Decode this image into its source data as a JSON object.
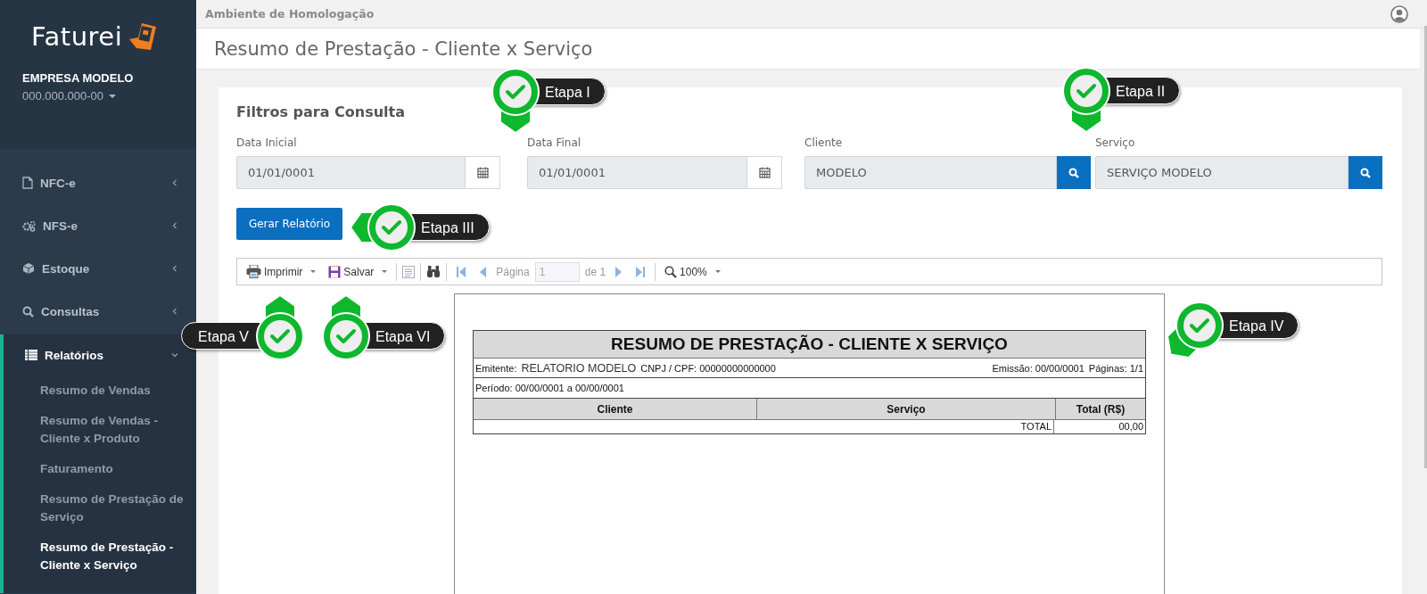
{
  "environment": "Ambiente de Homologação",
  "page_title": "Resumo de Prestação - Cliente x Serviço",
  "sidebar": {
    "logo": "Faturei",
    "company": "EMPRESA MODELO",
    "company_id": "000.000.000-00",
    "items": [
      {
        "label": "NFC-e",
        "kind": "file",
        "expanded": false
      },
      {
        "label": "NFS-e",
        "kind": "gears",
        "expanded": false
      },
      {
        "label": "Estoque",
        "kind": "cube",
        "expanded": false
      },
      {
        "label": "Consultas",
        "kind": "search",
        "expanded": false
      },
      {
        "label": "Relatórios",
        "kind": "list",
        "expanded": true,
        "children": [
          {
            "label": "Resumo de Vendas",
            "selected": false
          },
          {
            "label": "Resumo de Vendas - Cliente x Produto",
            "selected": false
          },
          {
            "label": "Faturamento",
            "selected": false
          },
          {
            "label": "Resumo de Prestação de Serviço",
            "selected": false
          },
          {
            "label": "Resumo de Prestação - Cliente x Serviço",
            "selected": true
          }
        ]
      }
    ]
  },
  "filters": {
    "title": "Filtros para Consulta",
    "fields": [
      {
        "label": "Data Inicial",
        "value": "01/01/0001",
        "kind": "date"
      },
      {
        "label": "Data Final",
        "value": "01/01/0001",
        "kind": "date"
      },
      {
        "label": "Cliente",
        "value": "MODELO",
        "kind": "lookup"
      },
      {
        "label": "Serviço",
        "value": "SERVIÇO MODELO",
        "kind": "lookup"
      }
    ],
    "submit": "Gerar Relatório"
  },
  "viewer": {
    "toolbar": {
      "print": "Imprimir",
      "save": "Salvar",
      "page_label": "Página",
      "page": "1",
      "page_of": "de 1",
      "zoom": "100%"
    },
    "report": {
      "title": "RESUMO DE PRESTAÇÃO - CLIENTE X SERVIÇO",
      "issuer_label": "Emitente:",
      "issuer": "RELATORIO MODELO",
      "tax_id": "CNPJ / CPF: 00000000000000",
      "issued": "Emissão: 00/00/0001",
      "pages": "Páginas: 1/1",
      "period": "Período: 00/00/0001 a 00/00/0001",
      "columns": [
        "Cliente",
        "Serviço",
        "Total (R$)"
      ],
      "total_label": "TOTAL",
      "total": "00,00"
    }
  },
  "steps": [
    {
      "label": "Etapa I",
      "kind": "down"
    },
    {
      "label": "Etapa II",
      "kind": "down"
    },
    {
      "label": "Etapa III",
      "kind": "left"
    },
    {
      "label": "Etapa IV",
      "kind": "down-left"
    },
    {
      "label": "Etapa V",
      "kind": "up-flipped"
    },
    {
      "label": "Etapa VI",
      "kind": "up"
    }
  ]
}
